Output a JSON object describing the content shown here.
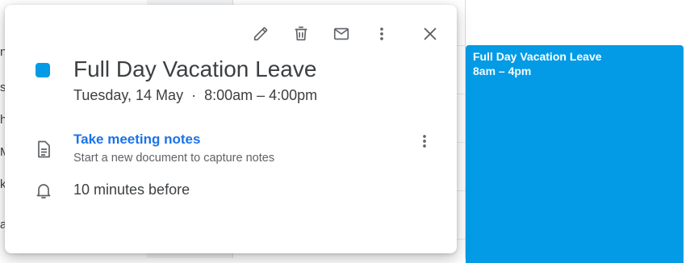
{
  "event": {
    "title": "Full Day Vacation Leave",
    "date": "Tuesday, 14 May",
    "separator": "·",
    "time_range": "8:00am – 4:00pm",
    "color": "#039be5"
  },
  "toolbar": {
    "edit": "edit-icon",
    "delete": "delete-icon",
    "email": "email-icon",
    "more": "more-vert-icon",
    "close": "close-icon"
  },
  "notes": {
    "link_label": "Take meeting notes",
    "subtitle": "Start a new document to capture notes"
  },
  "reminder": {
    "text": "10 minutes before"
  },
  "calendar_event": {
    "title": "Full Day Vacation Leave",
    "time": "8am – 4pm",
    "color": "#039be5"
  },
  "background_fragments": [
    "n",
    "so",
    "h",
    "M",
    "k",
    "a"
  ]
}
